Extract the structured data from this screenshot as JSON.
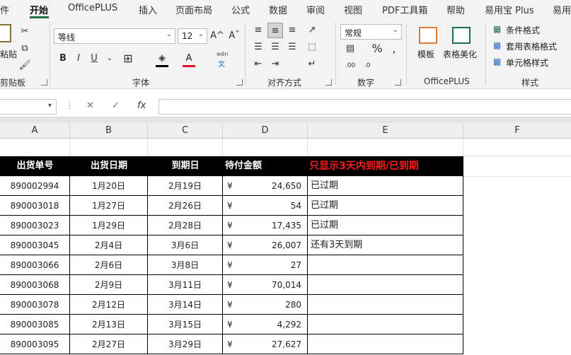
{
  "tabs": [
    "件",
    "开始",
    "OfficePLUS",
    "插入",
    "页面布局",
    "公式",
    "数据",
    "审阅",
    "视图",
    "PDF工具箱",
    "帮助",
    "易用宝 Plus",
    "易用"
  ],
  "ribbon": {
    "clipboard": {
      "paste_label": "粘贴",
      "group_label": "剪贴板"
    },
    "font": {
      "name": "等线",
      "size": "12",
      "grow": "A",
      "shrink": "A",
      "bold": "B",
      "italic": "I",
      "underline": "U",
      "wen": "wén",
      "wen2": "文",
      "group_label": "字体"
    },
    "alignment": {
      "group_label": "对齐方式"
    },
    "number": {
      "format": "常规",
      "percent": "%",
      "comma": ",",
      "group_label": "数字"
    },
    "officeplus": {
      "template_label": "模板",
      "beautify_label": "表格美化",
      "group_label": "OfficePLUS"
    },
    "styles": {
      "cond_format": "条件格式",
      "table_format": "套用表格格式",
      "cell_style": "单元格样式",
      "group_label": "样式"
    }
  },
  "formula_bar": {
    "cancel": "✕",
    "enter": "✓",
    "fx": "fx",
    "value": ""
  },
  "columns": [
    "A",
    "B",
    "C",
    "D",
    "E",
    "F"
  ],
  "table": {
    "headers": [
      "出货单号",
      "出货日期",
      "到期日",
      "待付金额"
    ],
    "note": "只显示3天内到期/已到期",
    "currency": "¥",
    "rows": [
      {
        "id": "890002994",
        "ship": "1月20日",
        "due": "2月19日",
        "amount": "24,650",
        "status": "已过期"
      },
      {
        "id": "890003018",
        "ship": "1月27日",
        "due": "2月26日",
        "amount": "54",
        "status": "已过期"
      },
      {
        "id": "890003023",
        "ship": "1月29日",
        "due": "2月28日",
        "amount": "17,435",
        "status": "已过期"
      },
      {
        "id": "890003045",
        "ship": "2月4日",
        "due": "3月6日",
        "amount": "26,007",
        "status": "还有3天到期"
      },
      {
        "id": "890003066",
        "ship": "2月6日",
        "due": "3月8日",
        "amount": "27",
        "status": ""
      },
      {
        "id": "890003068",
        "ship": "2月9日",
        "due": "3月11日",
        "amount": "70,014",
        "status": ""
      },
      {
        "id": "890003078",
        "ship": "2月12日",
        "due": "3月14日",
        "amount": "280",
        "status": ""
      },
      {
        "id": "890003085",
        "ship": "2月13日",
        "due": "3月15日",
        "amount": "4,292",
        "status": ""
      },
      {
        "id": "890003095",
        "ship": "2月27日",
        "due": "3月29日",
        "amount": "27,627",
        "status": ""
      }
    ]
  },
  "colors": {
    "accent": "#1e7145",
    "note_red": "#ff1a1a",
    "header_bg": "#000000"
  }
}
